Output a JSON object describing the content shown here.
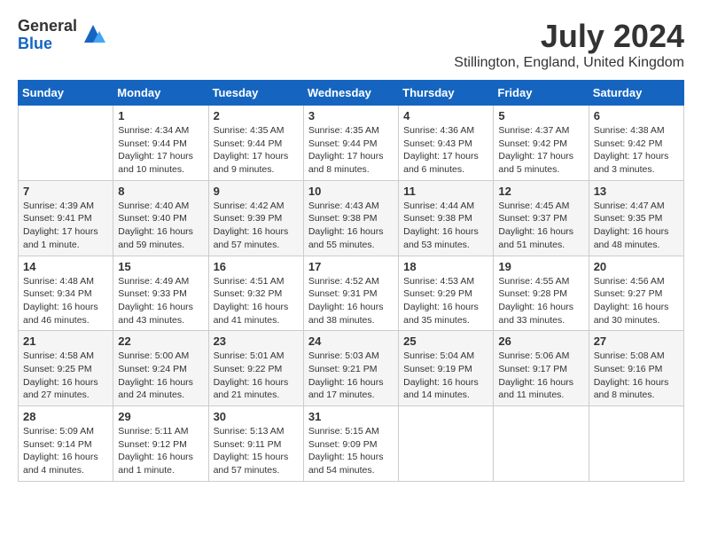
{
  "header": {
    "logo_general": "General",
    "logo_blue": "Blue",
    "title": "July 2024",
    "location": "Stillington, England, United Kingdom"
  },
  "days_of_week": [
    "Sunday",
    "Monday",
    "Tuesday",
    "Wednesday",
    "Thursday",
    "Friday",
    "Saturday"
  ],
  "weeks": [
    [
      {
        "day": "",
        "info": ""
      },
      {
        "day": "1",
        "info": "Sunrise: 4:34 AM\nSunset: 9:44 PM\nDaylight: 17 hours\nand 10 minutes."
      },
      {
        "day": "2",
        "info": "Sunrise: 4:35 AM\nSunset: 9:44 PM\nDaylight: 17 hours\nand 9 minutes."
      },
      {
        "day": "3",
        "info": "Sunrise: 4:35 AM\nSunset: 9:44 PM\nDaylight: 17 hours\nand 8 minutes."
      },
      {
        "day": "4",
        "info": "Sunrise: 4:36 AM\nSunset: 9:43 PM\nDaylight: 17 hours\nand 6 minutes."
      },
      {
        "day": "5",
        "info": "Sunrise: 4:37 AM\nSunset: 9:42 PM\nDaylight: 17 hours\nand 5 minutes."
      },
      {
        "day": "6",
        "info": "Sunrise: 4:38 AM\nSunset: 9:42 PM\nDaylight: 17 hours\nand 3 minutes."
      }
    ],
    [
      {
        "day": "7",
        "info": "Sunrise: 4:39 AM\nSunset: 9:41 PM\nDaylight: 17 hours\nand 1 minute."
      },
      {
        "day": "8",
        "info": "Sunrise: 4:40 AM\nSunset: 9:40 PM\nDaylight: 16 hours\nand 59 minutes."
      },
      {
        "day": "9",
        "info": "Sunrise: 4:42 AM\nSunset: 9:39 PM\nDaylight: 16 hours\nand 57 minutes."
      },
      {
        "day": "10",
        "info": "Sunrise: 4:43 AM\nSunset: 9:38 PM\nDaylight: 16 hours\nand 55 minutes."
      },
      {
        "day": "11",
        "info": "Sunrise: 4:44 AM\nSunset: 9:38 PM\nDaylight: 16 hours\nand 53 minutes."
      },
      {
        "day": "12",
        "info": "Sunrise: 4:45 AM\nSunset: 9:37 PM\nDaylight: 16 hours\nand 51 minutes."
      },
      {
        "day": "13",
        "info": "Sunrise: 4:47 AM\nSunset: 9:35 PM\nDaylight: 16 hours\nand 48 minutes."
      }
    ],
    [
      {
        "day": "14",
        "info": "Sunrise: 4:48 AM\nSunset: 9:34 PM\nDaylight: 16 hours\nand 46 minutes."
      },
      {
        "day": "15",
        "info": "Sunrise: 4:49 AM\nSunset: 9:33 PM\nDaylight: 16 hours\nand 43 minutes."
      },
      {
        "day": "16",
        "info": "Sunrise: 4:51 AM\nSunset: 9:32 PM\nDaylight: 16 hours\nand 41 minutes."
      },
      {
        "day": "17",
        "info": "Sunrise: 4:52 AM\nSunset: 9:31 PM\nDaylight: 16 hours\nand 38 minutes."
      },
      {
        "day": "18",
        "info": "Sunrise: 4:53 AM\nSunset: 9:29 PM\nDaylight: 16 hours\nand 35 minutes."
      },
      {
        "day": "19",
        "info": "Sunrise: 4:55 AM\nSunset: 9:28 PM\nDaylight: 16 hours\nand 33 minutes."
      },
      {
        "day": "20",
        "info": "Sunrise: 4:56 AM\nSunset: 9:27 PM\nDaylight: 16 hours\nand 30 minutes."
      }
    ],
    [
      {
        "day": "21",
        "info": "Sunrise: 4:58 AM\nSunset: 9:25 PM\nDaylight: 16 hours\nand 27 minutes."
      },
      {
        "day": "22",
        "info": "Sunrise: 5:00 AM\nSunset: 9:24 PM\nDaylight: 16 hours\nand 24 minutes."
      },
      {
        "day": "23",
        "info": "Sunrise: 5:01 AM\nSunset: 9:22 PM\nDaylight: 16 hours\nand 21 minutes."
      },
      {
        "day": "24",
        "info": "Sunrise: 5:03 AM\nSunset: 9:21 PM\nDaylight: 16 hours\nand 17 minutes."
      },
      {
        "day": "25",
        "info": "Sunrise: 5:04 AM\nSunset: 9:19 PM\nDaylight: 16 hours\nand 14 minutes."
      },
      {
        "day": "26",
        "info": "Sunrise: 5:06 AM\nSunset: 9:17 PM\nDaylight: 16 hours\nand 11 minutes."
      },
      {
        "day": "27",
        "info": "Sunrise: 5:08 AM\nSunset: 9:16 PM\nDaylight: 16 hours\nand 8 minutes."
      }
    ],
    [
      {
        "day": "28",
        "info": "Sunrise: 5:09 AM\nSunset: 9:14 PM\nDaylight: 16 hours\nand 4 minutes."
      },
      {
        "day": "29",
        "info": "Sunrise: 5:11 AM\nSunset: 9:12 PM\nDaylight: 16 hours\nand 1 minute."
      },
      {
        "day": "30",
        "info": "Sunrise: 5:13 AM\nSunset: 9:11 PM\nDaylight: 15 hours\nand 57 minutes."
      },
      {
        "day": "31",
        "info": "Sunrise: 5:15 AM\nSunset: 9:09 PM\nDaylight: 15 hours\nand 54 minutes."
      },
      {
        "day": "",
        "info": ""
      },
      {
        "day": "",
        "info": ""
      },
      {
        "day": "",
        "info": ""
      }
    ]
  ]
}
